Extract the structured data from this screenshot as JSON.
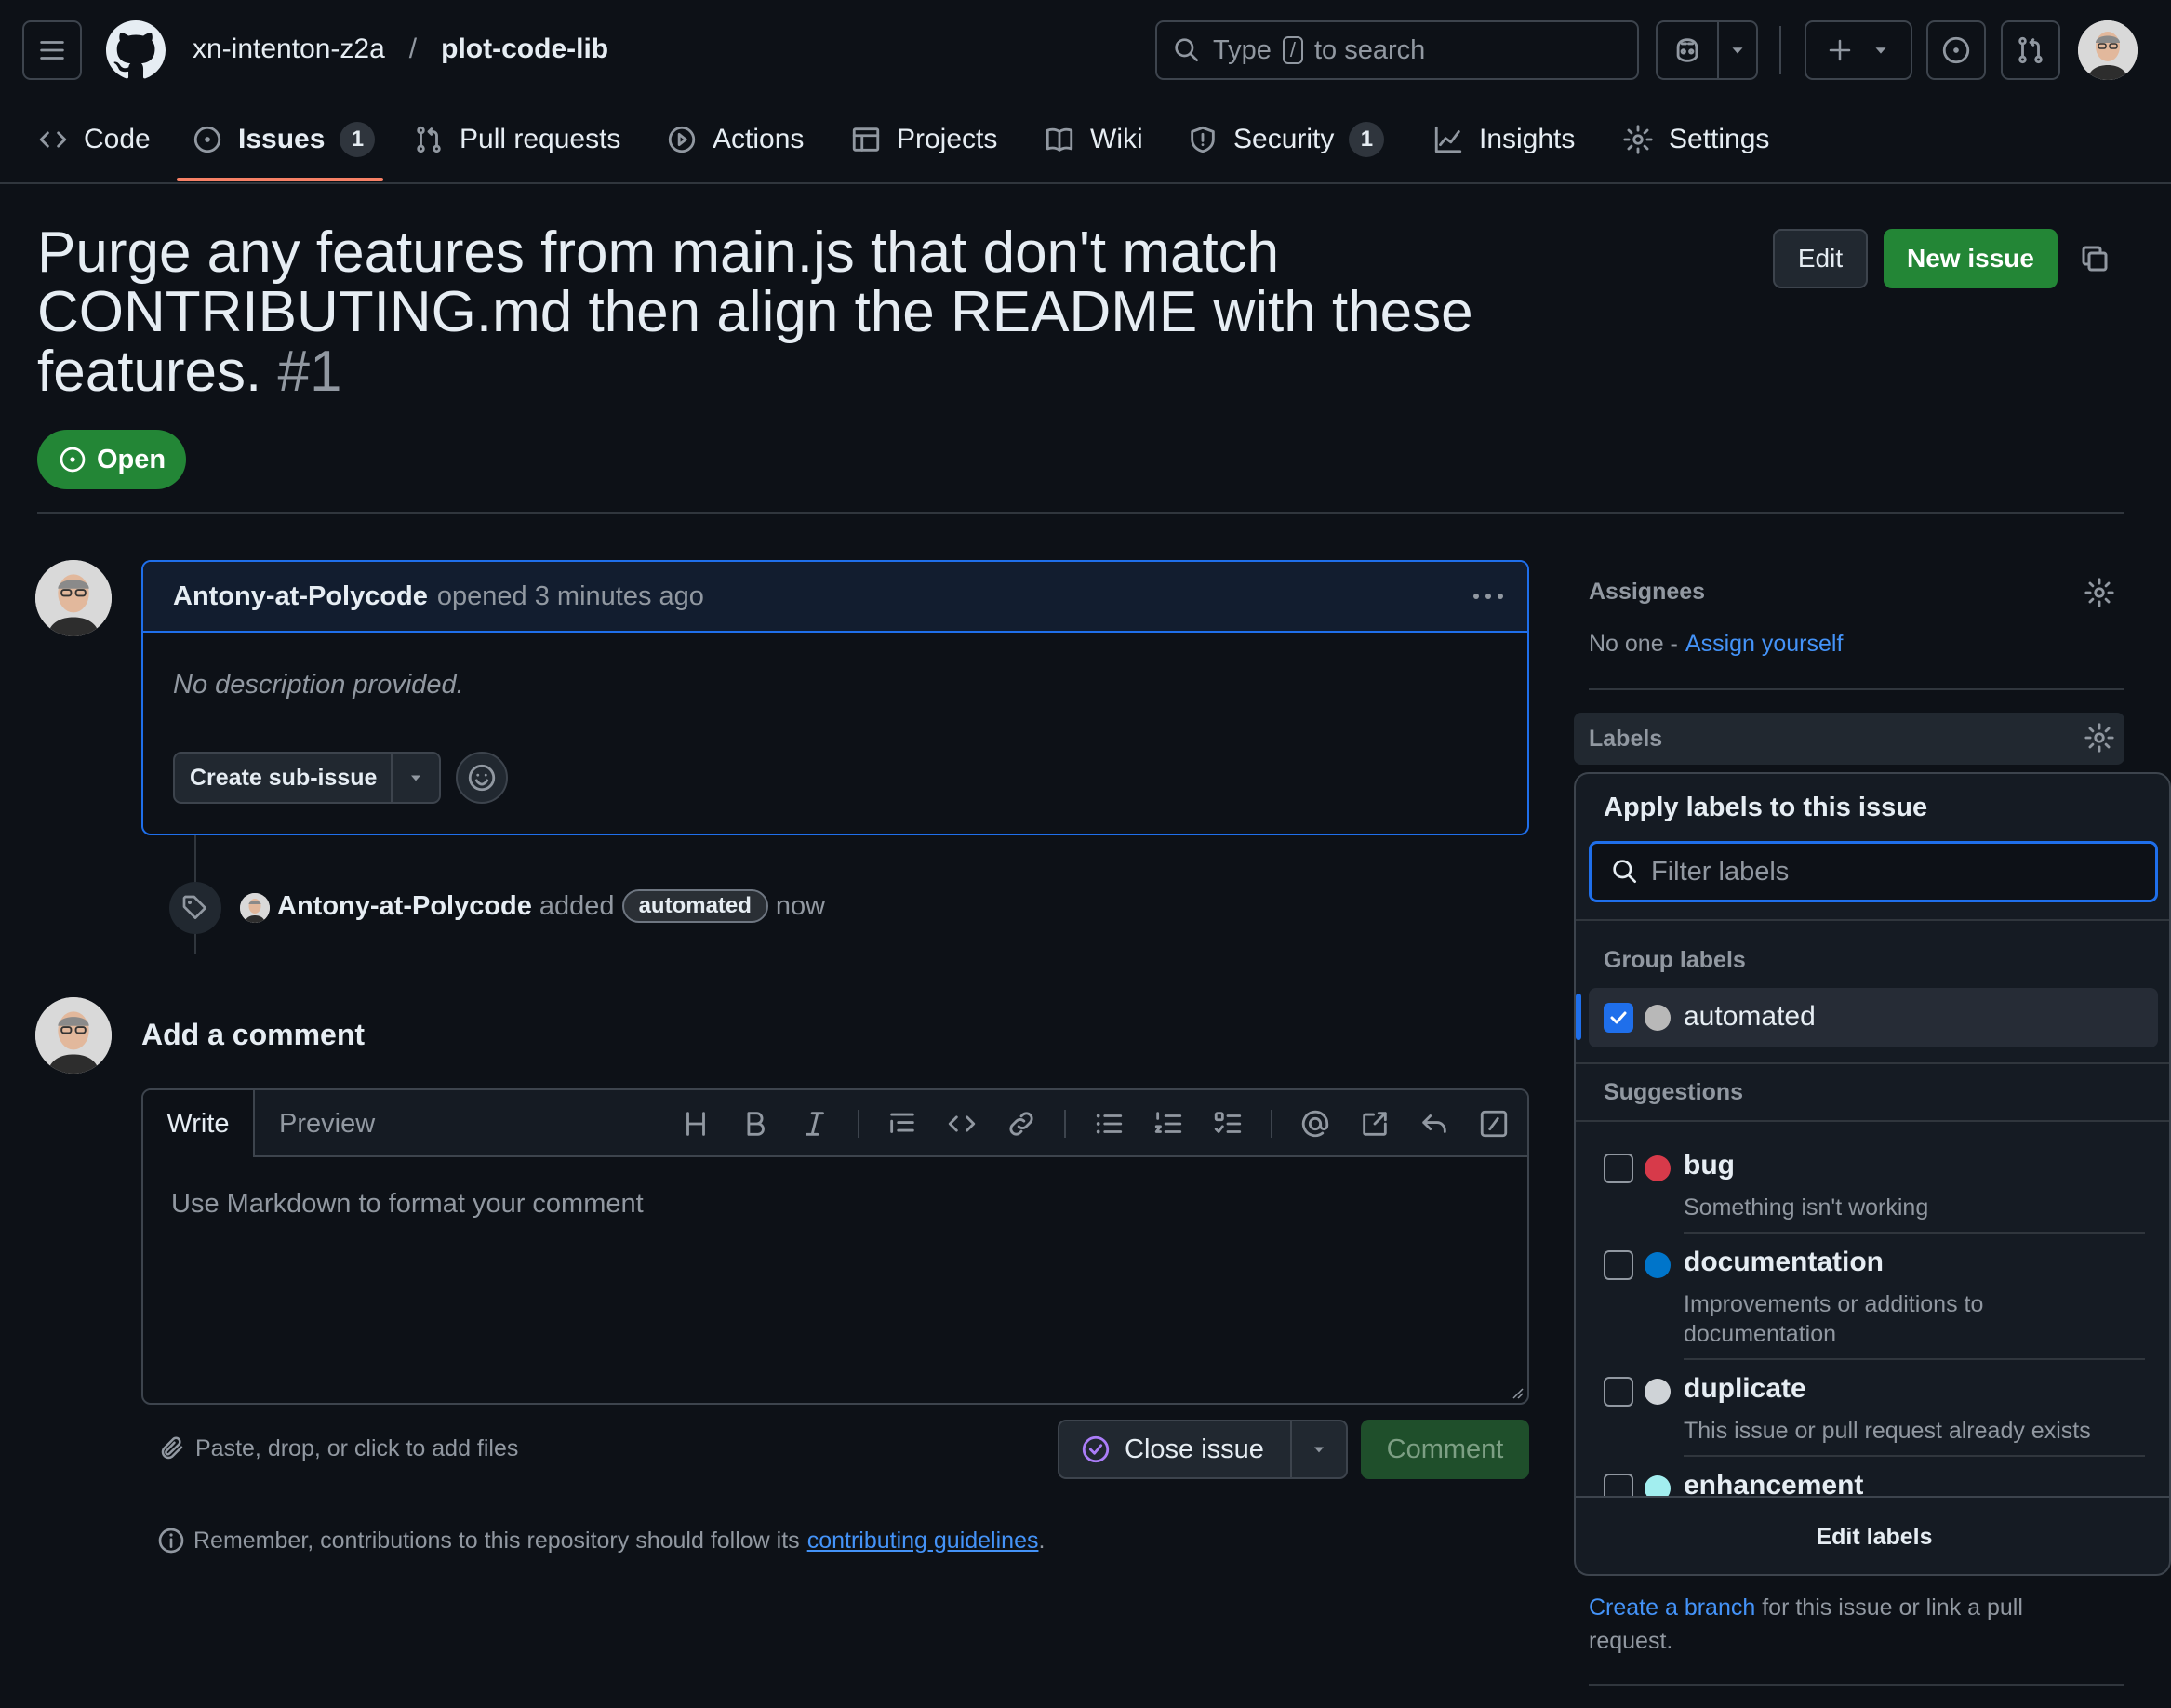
{
  "header": {
    "owner": "xn-intenton-z2a",
    "separator": "/",
    "repo": "plot-code-lib",
    "search_prefix": "Type",
    "search_key": "/",
    "search_suffix": "to search"
  },
  "nav": {
    "tabs": [
      {
        "label": "Code"
      },
      {
        "label": "Issues",
        "count": "1"
      },
      {
        "label": "Pull requests"
      },
      {
        "label": "Actions"
      },
      {
        "label": "Projects"
      },
      {
        "label": "Wiki"
      },
      {
        "label": "Security",
        "count": "1"
      },
      {
        "label": "Insights"
      },
      {
        "label": "Settings"
      }
    ]
  },
  "issue": {
    "title_line1": "Purge any features from main.js that don't match",
    "title_line2": "CONTRIBUTING.md then align the README with these",
    "title_line3": "features.",
    "number": "#1",
    "state": "Open",
    "edit_label": "Edit",
    "new_issue_label": "New issue"
  },
  "comment": {
    "author": "Antony-at-Polycode",
    "action": "opened 3 minutes ago",
    "body": "No description provided.",
    "sub_issue_label": "Create sub-issue"
  },
  "event": {
    "actor": "Antony-at-Polycode",
    "verb": "added",
    "label": "automated",
    "time": "now"
  },
  "composer": {
    "heading": "Add a comment",
    "tab_write": "Write",
    "tab_preview": "Preview",
    "placeholder": "Use Markdown to format your comment",
    "attach_hint": "Paste, drop, or click to add files",
    "close_issue_label": "Close issue",
    "comment_label": "Comment",
    "notice_prefix": "Remember, contributions to this repository should follow its",
    "notice_link": "contributing guidelines",
    "notice_suffix": "."
  },
  "sidebar": {
    "assignees_heading": "Assignees",
    "assignees_none": "No one -",
    "assign_yourself": "Assign yourself",
    "labels_heading": "Labels",
    "create_branch_link": "Create a branch",
    "create_branch_rest_line1": "for this issue or link a pull",
    "create_branch_rest_line2": "request."
  },
  "labels_popover": {
    "title": "Apply labels to this issue",
    "filter_placeholder": "Filter labels",
    "group_heading": "Group labels",
    "group_items": [
      {
        "name": "automated",
        "checked": true,
        "color": "#b8b8b8"
      }
    ],
    "suggestions_heading": "Suggestions",
    "suggestions": [
      {
        "name": "bug",
        "desc_line1": "Something isn't working",
        "desc_line2": "",
        "color": "#d73a4a"
      },
      {
        "name": "documentation",
        "desc_line1": "Improvements or additions to",
        "desc_line2": "documentation",
        "color": "#0075ca"
      },
      {
        "name": "duplicate",
        "desc_line1": "This issue or pull request already exists",
        "desc_line2": "",
        "color": "#cfd3d7"
      },
      {
        "name": "enhancement",
        "desc_line1": "",
        "desc_line2": "",
        "color": "#a2eeef"
      }
    ],
    "edit_labels": "Edit labels"
  },
  "colors": {
    "accent_link": "#4493f8",
    "open_green": "#238636",
    "tab_underline": "#f78166",
    "checkbox_blue": "#1f6feb"
  }
}
